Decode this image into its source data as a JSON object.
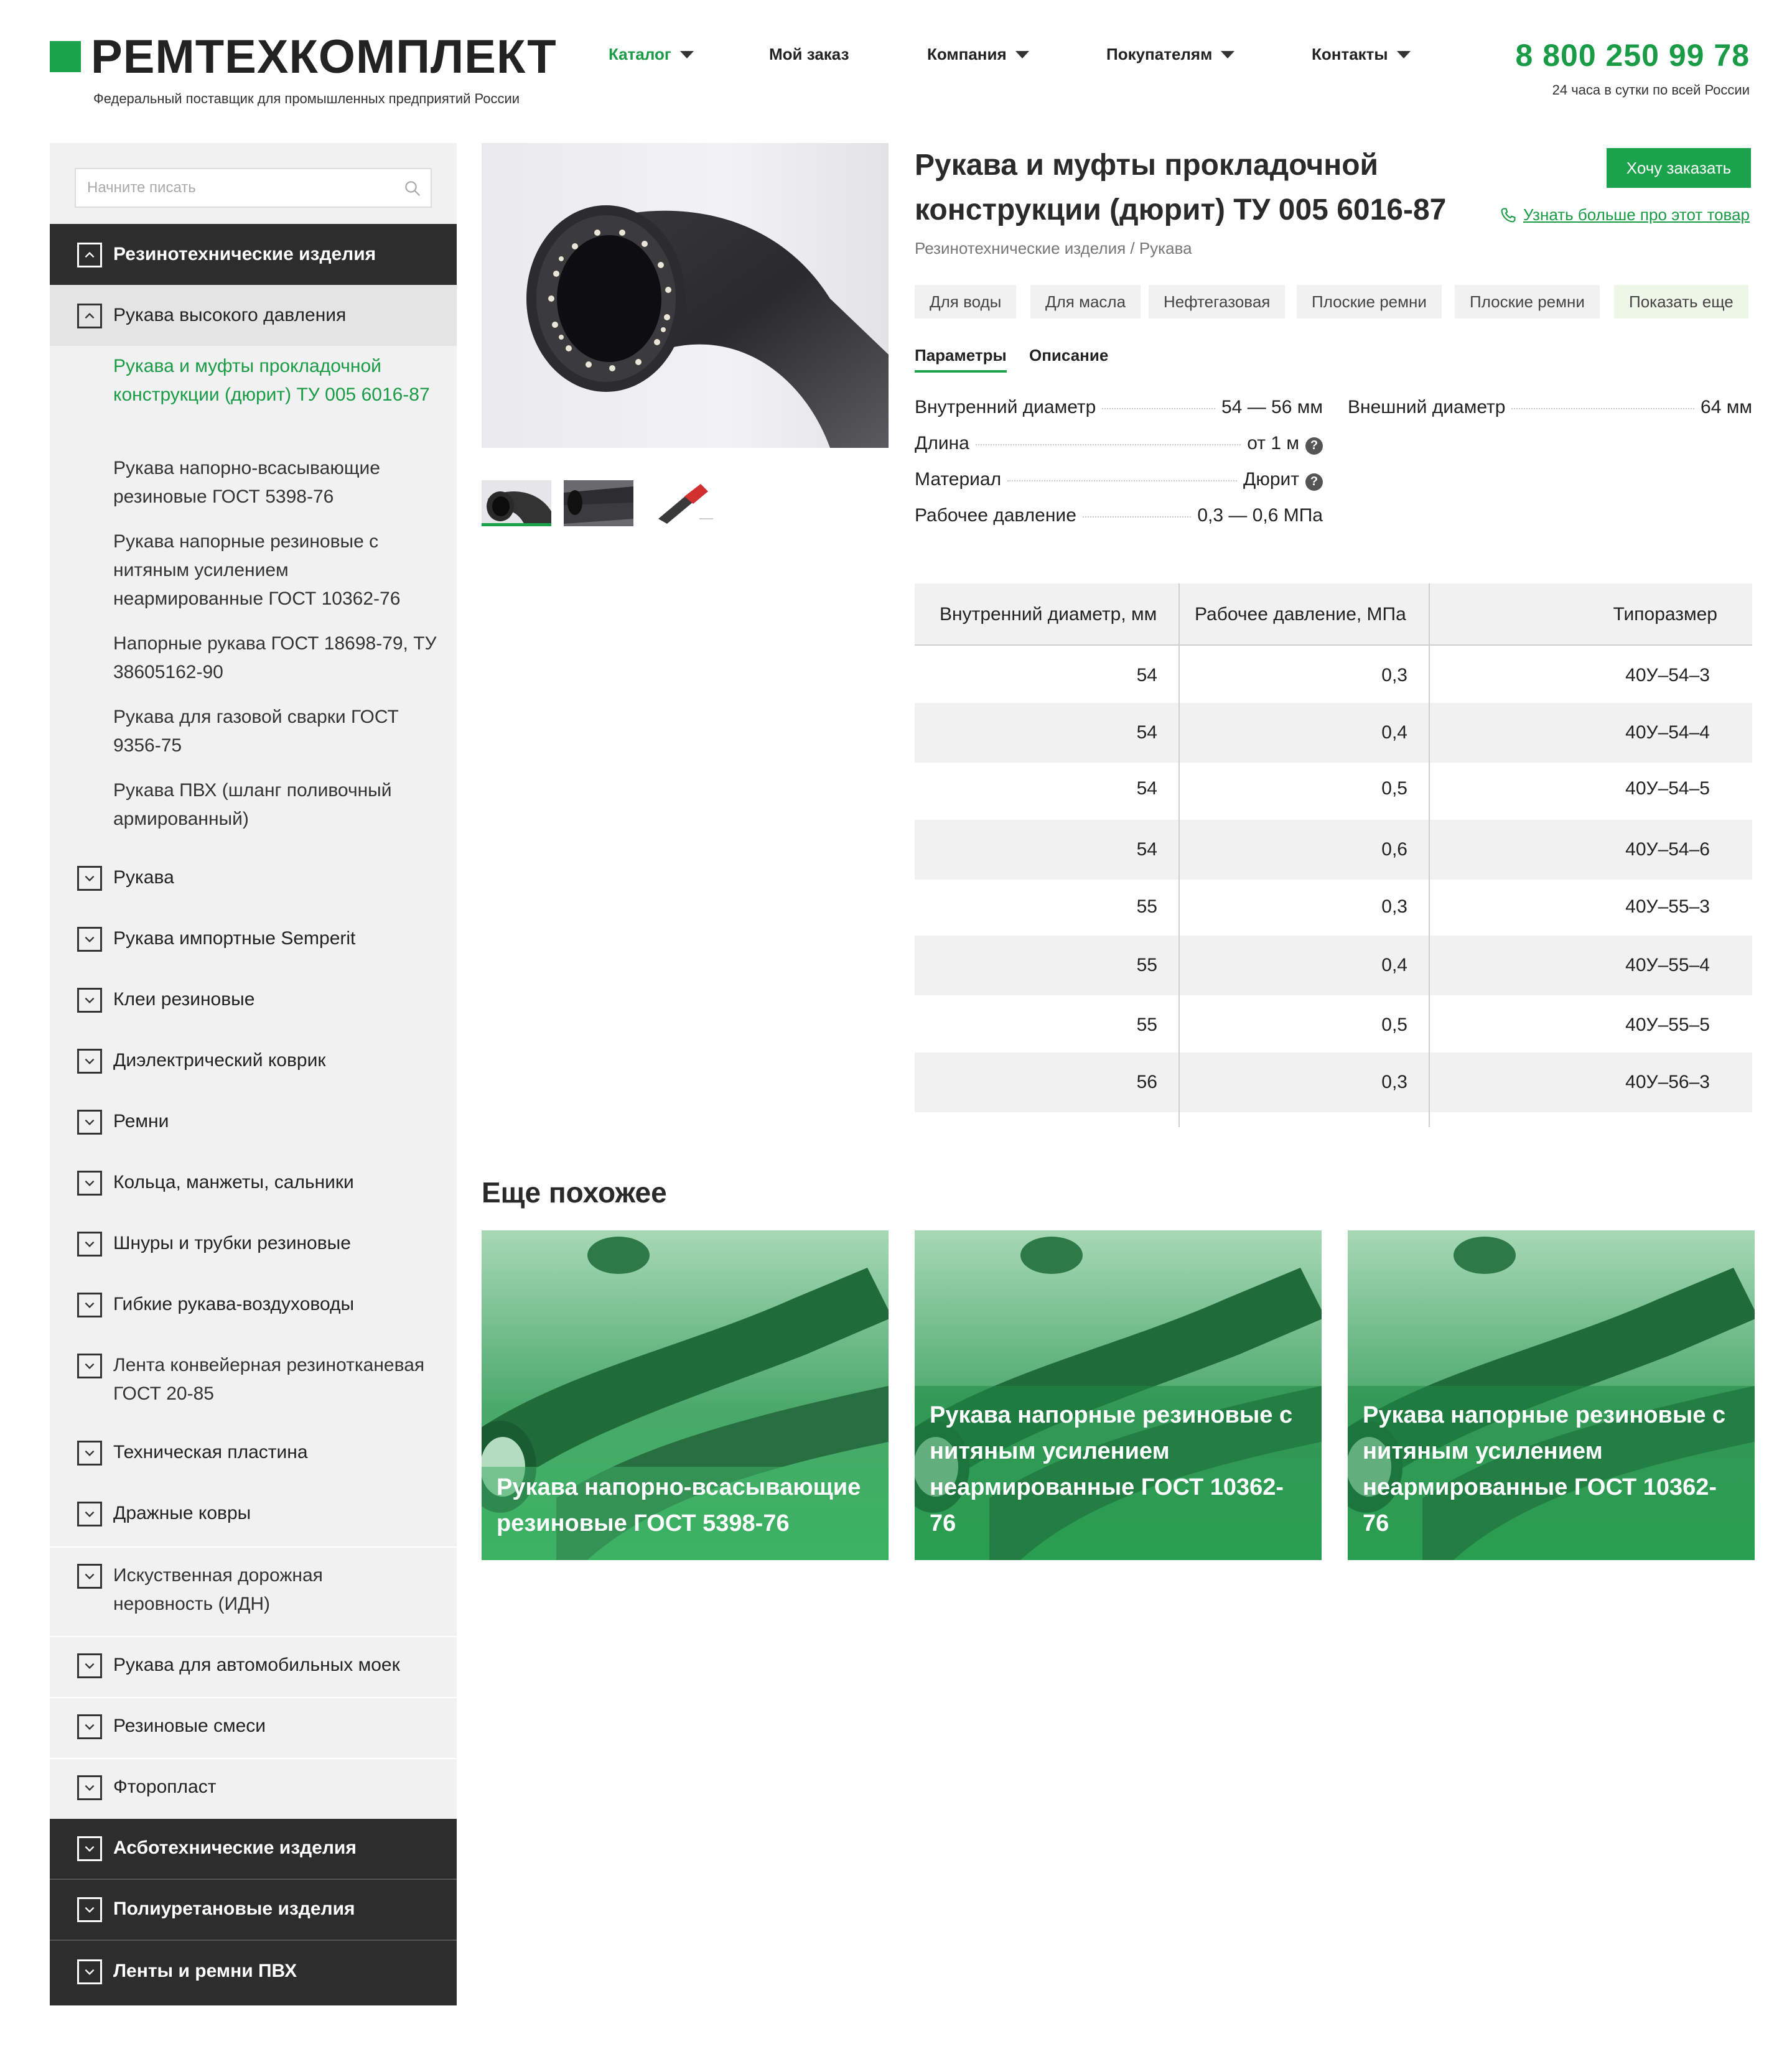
{
  "header": {
    "logo_text": "РЕМТЕХКОМПЛЕКТ",
    "logo_subtitle": "Федеральный поставщик для промышленных предприятий России",
    "nav": [
      {
        "label": "Каталог",
        "has_dropdown": true,
        "active": true
      },
      {
        "label": "Мой заказ",
        "has_dropdown": false
      },
      {
        "label": "Компания",
        "has_dropdown": true
      },
      {
        "label": "Покупателям",
        "has_dropdown": true
      },
      {
        "label": "Контакты",
        "has_dropdown": true
      }
    ],
    "phone": "8 800 250 99 78",
    "phone_note": "24 часа в сутки по всей России"
  },
  "sidebar": {
    "search_placeholder": "Начните писать",
    "sections": [
      {
        "label": "Резинотехнические изделия",
        "expanded": true,
        "style": "dark"
      },
      {
        "label": "Рукава высокого давления",
        "expanded": true,
        "style": "gray"
      },
      {
        "label": "Рукава",
        "expanded": false
      },
      {
        "label": "Рукава импортные Semperit",
        "expanded": false
      },
      {
        "label": "Клеи резиновые",
        "expanded": false
      },
      {
        "label": "Диэлектрический коврик",
        "expanded": false
      },
      {
        "label": "Ремни",
        "expanded": false
      },
      {
        "label": "Кольца, манжеты, сальники",
        "expanded": false
      },
      {
        "label": "Шнуры и трубки резиновые",
        "expanded": false
      },
      {
        "label": "Гибкие рукава-воздуховоды",
        "expanded": false
      },
      {
        "label": "Лента конвейерная резинотканевая ГОСТ 20-85",
        "expanded": false
      },
      {
        "label": "Техническая пластина",
        "expanded": false
      },
      {
        "label": "Дражные ковры",
        "expanded": false
      },
      {
        "label": "Искуственная дорожная неровность (ИДН)",
        "expanded": false
      },
      {
        "label": "Рукава для автомобильных моек",
        "expanded": false
      },
      {
        "label": "Резиновые смеси",
        "expanded": false
      },
      {
        "label": "Фторопласт",
        "expanded": false
      },
      {
        "label": "Асботехнические изделия",
        "expanded": false,
        "style": "dark"
      },
      {
        "label": "Полиуретановые изделия",
        "expanded": false,
        "style": "dark"
      },
      {
        "label": "Ленты и ремни ПВХ",
        "expanded": false,
        "style": "dark"
      }
    ],
    "sub_items": [
      {
        "label": "Рукава и муфты прокладочной конструкции (дюрит) ТУ 005 6016-87",
        "active": true
      },
      {
        "label": "Рукава напорно-всасывающие резиновые ГОСТ 5398-76"
      },
      {
        "label": "Рукава напорные резиновые с нитяным усилением неармированные ГОСТ 10362-76"
      },
      {
        "label": "Напорные рукава ГОСТ 18698-79, ТУ 38605162-90"
      },
      {
        "label": "Рукава для газовой сварки ГОСТ 9356-75"
      },
      {
        "label": "Рукава ПВХ (шланг поливочный армированный)"
      }
    ]
  },
  "product": {
    "title": "Рукава и муфты прокладочной конструкции (дюрит) ТУ 005 6016-87",
    "breadcrumb": "Резинотехнические изделия / Рукава",
    "order_button": "Хочу заказать",
    "learn_more": "Узнать больше про этот товар",
    "tags": [
      "Для воды",
      "Для масла",
      "Нефтегазовая",
      "Плоские ремни",
      "Плоские ремни",
      "Показать еще"
    ],
    "tabs": [
      "Параметры",
      "Описание"
    ],
    "params": [
      {
        "name": "Внутренний диаметр",
        "value": "54 — 56 мм"
      },
      {
        "name": "Длина",
        "value": "от 1 м",
        "help": true
      },
      {
        "name": "Материал",
        "value": "Дюрит",
        "help": true
      },
      {
        "name": "Рабочее давление",
        "value": "0,3 — 0,6 МПа"
      },
      {
        "name": "Внешний диаметр",
        "value": "64 мм"
      }
    ],
    "help_glyph": "?",
    "thumbnails": [
      "thumb-hose-black",
      "thumb-hose-gray",
      "thumb-hose-red"
    ]
  },
  "table": {
    "headers": [
      "Внутренний диаметр, мм",
      "Рабочее давление, МПа",
      "Типоразмер"
    ],
    "rows": [
      [
        "54",
        "0,3",
        "40У–54–3"
      ],
      [
        "54",
        "0,4",
        "40У–54–4"
      ],
      [
        "54",
        "0,5",
        "40У–54–5"
      ],
      [
        "54",
        "0,6",
        "40У–54–6"
      ],
      [
        "55",
        "0,3",
        "40У–55–3"
      ],
      [
        "55",
        "0,4",
        "40У–55–4"
      ],
      [
        "55",
        "0,5",
        "40У–55–5"
      ],
      [
        "56",
        "0,3",
        "40У–56–3"
      ]
    ]
  },
  "similar": {
    "title": "Еще похожее",
    "cards": [
      {
        "title": "Рукава напорно-всасывающие резиновые ГОСТ 5398-76"
      },
      {
        "title": "Рукава напорные резиновые с нитяным усилением неармированные ГОСТ 10362-76"
      },
      {
        "title": "Рукава напорные резиновые с нитяным усилением неармированные ГОСТ 10362-76"
      }
    ]
  },
  "colors": {
    "brand_green": "#1aa34a",
    "link_green": "#1a9b45",
    "sidebar_dark": "#2d2d2d",
    "sidebar_bg": "#f1f1f1"
  }
}
